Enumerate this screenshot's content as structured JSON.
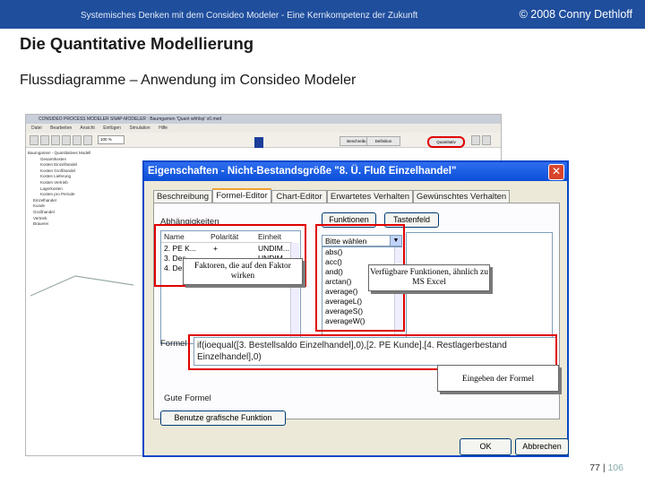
{
  "header": {
    "left_text": "Systemisches Denken mit dem Consideo Modeler - Eine Kernkompetenz der Zukunft",
    "right_text": "© 2008 Conny Dethloff",
    "background": "#1f4e9d"
  },
  "slide": {
    "title": "Die Quantitative Modellierung",
    "subtitle": "Flussdiagramme – Anwendung im Consideo Modeler",
    "page_current": "77",
    "page_sep": "|",
    "page_total": "106"
  },
  "app": {
    "title": "CONSIDEO PROCESS MODELER SNAP-MODELER : Baumgamen 'Quant whhlsp' v0.med",
    "menu": [
      "Datei",
      "Bearbeiten",
      "Ansicht",
      "Einfügen",
      "Simulation",
      "Hilfe"
    ],
    "zoom": "100 %",
    "tabs": [
      "Beschreibung",
      "Definition",
      "Quantitativ"
    ],
    "tree": [
      "Baumgamen - Quantitatives Modell",
      "Gesamtkosten",
      "Kosten Einzelhandel",
      "Kosten Großhandel",
      "Kosten Lieferung",
      "Kosten Vertrieb",
      "Lagerkosten",
      "Kosten pro Periode",
      "Einzelhandel",
      "Kunde",
      "Großhandel",
      "Vertrieb",
      "Brauerei"
    ]
  },
  "dialog": {
    "title": "Eigenschaften - Nicht-Bestandsgröße \"8. Ü. Fluß Einzelhandel\"",
    "close_glyph": "✕",
    "tabs": [
      "Beschreibung",
      "Formel-Editor",
      "Chart-Editor",
      "Erwartetes Verhalten",
      "Gewünschtes Verhalten"
    ],
    "active_tab": "Formel-Editor",
    "dependencies_label": "Abhängigkeiten",
    "table_headers": [
      "Name",
      "Polarität",
      "Einheit"
    ],
    "table_rows": [
      [
        "2. PE K...",
        "+",
        "UNDIM..."
      ],
      [
        "3. Des...",
        "",
        "UNDIM..."
      ],
      [
        "4. Des...",
        "",
        ""
      ]
    ],
    "btn_functions": "Funktionen",
    "btn_keypad": "Tastenfeld",
    "select_placeholder": "Bitte wählen",
    "functions": [
      "abs()",
      "acc()",
      "and()",
      "arctan()",
      "average()",
      "averageL()",
      "averageS()",
      "averageW()"
    ],
    "formula_label": "Formel",
    "formula_text": "if(ioequal([3. Bestellsaldo Einzelhandel],0),[2. PE Kunde],[4. Restlagerbestand Einzelhandel],0)",
    "quality_label": "Gute Formel",
    "btn_graphical": "Benutze grafische Funktion",
    "btn_ok": "OK",
    "btn_cancel": "Abbrechen",
    "accent": "#0a47c8"
  },
  "annotations": {
    "faktoren": "Faktoren, die auf den Faktor wirken",
    "funktionen": "Verfügbare Funktionen, ähnlich zu MS Excel",
    "formel": "Eingeben der Formel",
    "highlight_color": "#e00000"
  }
}
